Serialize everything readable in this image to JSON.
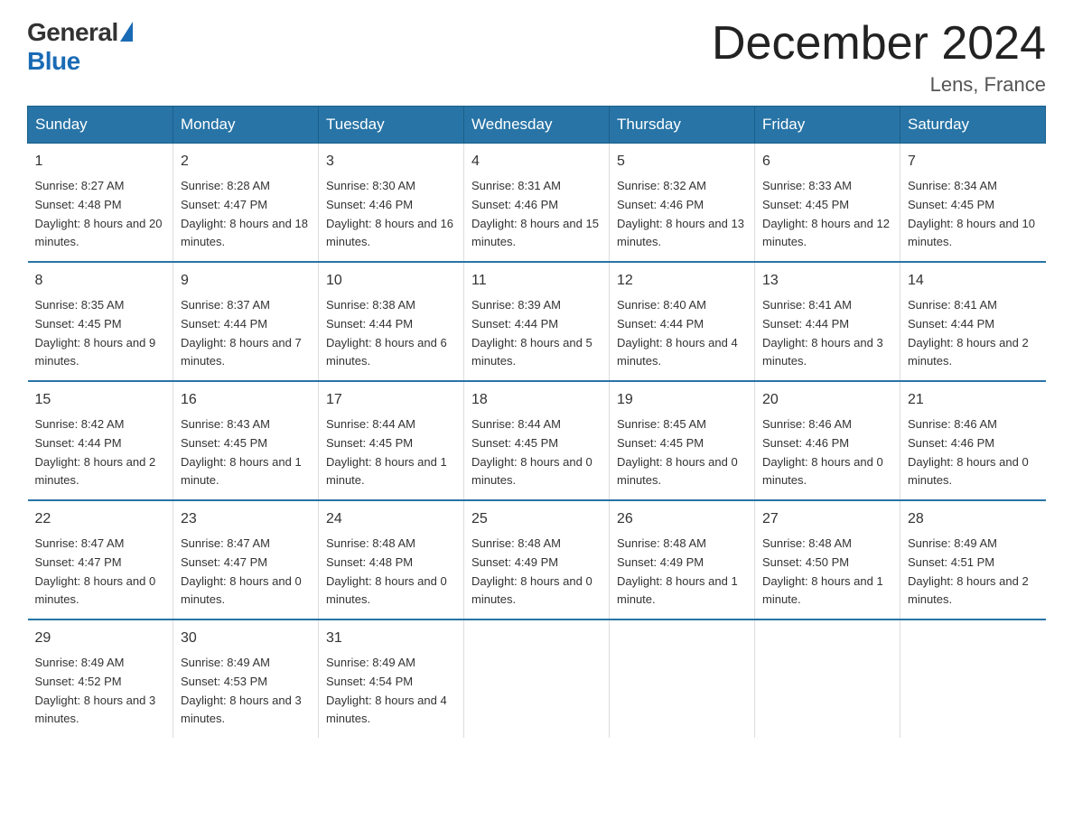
{
  "logo": {
    "general": "General",
    "blue": "Blue"
  },
  "title": "December 2024",
  "location": "Lens, France",
  "headers": [
    "Sunday",
    "Monday",
    "Tuesday",
    "Wednesday",
    "Thursday",
    "Friday",
    "Saturday"
  ],
  "weeks": [
    [
      {
        "day": "1",
        "sunrise": "8:27 AM",
        "sunset": "4:48 PM",
        "daylight": "8 hours and 20 minutes."
      },
      {
        "day": "2",
        "sunrise": "8:28 AM",
        "sunset": "4:47 PM",
        "daylight": "8 hours and 18 minutes."
      },
      {
        "day": "3",
        "sunrise": "8:30 AM",
        "sunset": "4:46 PM",
        "daylight": "8 hours and 16 minutes."
      },
      {
        "day": "4",
        "sunrise": "8:31 AM",
        "sunset": "4:46 PM",
        "daylight": "8 hours and 15 minutes."
      },
      {
        "day": "5",
        "sunrise": "8:32 AM",
        "sunset": "4:46 PM",
        "daylight": "8 hours and 13 minutes."
      },
      {
        "day": "6",
        "sunrise": "8:33 AM",
        "sunset": "4:45 PM",
        "daylight": "8 hours and 12 minutes."
      },
      {
        "day": "7",
        "sunrise": "8:34 AM",
        "sunset": "4:45 PM",
        "daylight": "8 hours and 10 minutes."
      }
    ],
    [
      {
        "day": "8",
        "sunrise": "8:35 AM",
        "sunset": "4:45 PM",
        "daylight": "8 hours and 9 minutes."
      },
      {
        "day": "9",
        "sunrise": "8:37 AM",
        "sunset": "4:44 PM",
        "daylight": "8 hours and 7 minutes."
      },
      {
        "day": "10",
        "sunrise": "8:38 AM",
        "sunset": "4:44 PM",
        "daylight": "8 hours and 6 minutes."
      },
      {
        "day": "11",
        "sunrise": "8:39 AM",
        "sunset": "4:44 PM",
        "daylight": "8 hours and 5 minutes."
      },
      {
        "day": "12",
        "sunrise": "8:40 AM",
        "sunset": "4:44 PM",
        "daylight": "8 hours and 4 minutes."
      },
      {
        "day": "13",
        "sunrise": "8:41 AM",
        "sunset": "4:44 PM",
        "daylight": "8 hours and 3 minutes."
      },
      {
        "day": "14",
        "sunrise": "8:41 AM",
        "sunset": "4:44 PM",
        "daylight": "8 hours and 2 minutes."
      }
    ],
    [
      {
        "day": "15",
        "sunrise": "8:42 AM",
        "sunset": "4:44 PM",
        "daylight": "8 hours and 2 minutes."
      },
      {
        "day": "16",
        "sunrise": "8:43 AM",
        "sunset": "4:45 PM",
        "daylight": "8 hours and 1 minute."
      },
      {
        "day": "17",
        "sunrise": "8:44 AM",
        "sunset": "4:45 PM",
        "daylight": "8 hours and 1 minute."
      },
      {
        "day": "18",
        "sunrise": "8:44 AM",
        "sunset": "4:45 PM",
        "daylight": "8 hours and 0 minutes."
      },
      {
        "day": "19",
        "sunrise": "8:45 AM",
        "sunset": "4:45 PM",
        "daylight": "8 hours and 0 minutes."
      },
      {
        "day": "20",
        "sunrise": "8:46 AM",
        "sunset": "4:46 PM",
        "daylight": "8 hours and 0 minutes."
      },
      {
        "day": "21",
        "sunrise": "8:46 AM",
        "sunset": "4:46 PM",
        "daylight": "8 hours and 0 minutes."
      }
    ],
    [
      {
        "day": "22",
        "sunrise": "8:47 AM",
        "sunset": "4:47 PM",
        "daylight": "8 hours and 0 minutes."
      },
      {
        "day": "23",
        "sunrise": "8:47 AM",
        "sunset": "4:47 PM",
        "daylight": "8 hours and 0 minutes."
      },
      {
        "day": "24",
        "sunrise": "8:48 AM",
        "sunset": "4:48 PM",
        "daylight": "8 hours and 0 minutes."
      },
      {
        "day": "25",
        "sunrise": "8:48 AM",
        "sunset": "4:49 PM",
        "daylight": "8 hours and 0 minutes."
      },
      {
        "day": "26",
        "sunrise": "8:48 AM",
        "sunset": "4:49 PM",
        "daylight": "8 hours and 1 minute."
      },
      {
        "day": "27",
        "sunrise": "8:48 AM",
        "sunset": "4:50 PM",
        "daylight": "8 hours and 1 minute."
      },
      {
        "day": "28",
        "sunrise": "8:49 AM",
        "sunset": "4:51 PM",
        "daylight": "8 hours and 2 minutes."
      }
    ],
    [
      {
        "day": "29",
        "sunrise": "8:49 AM",
        "sunset": "4:52 PM",
        "daylight": "8 hours and 3 minutes."
      },
      {
        "day": "30",
        "sunrise": "8:49 AM",
        "sunset": "4:53 PM",
        "daylight": "8 hours and 3 minutes."
      },
      {
        "day": "31",
        "sunrise": "8:49 AM",
        "sunset": "4:54 PM",
        "daylight": "8 hours and 4 minutes."
      },
      null,
      null,
      null,
      null
    ]
  ]
}
